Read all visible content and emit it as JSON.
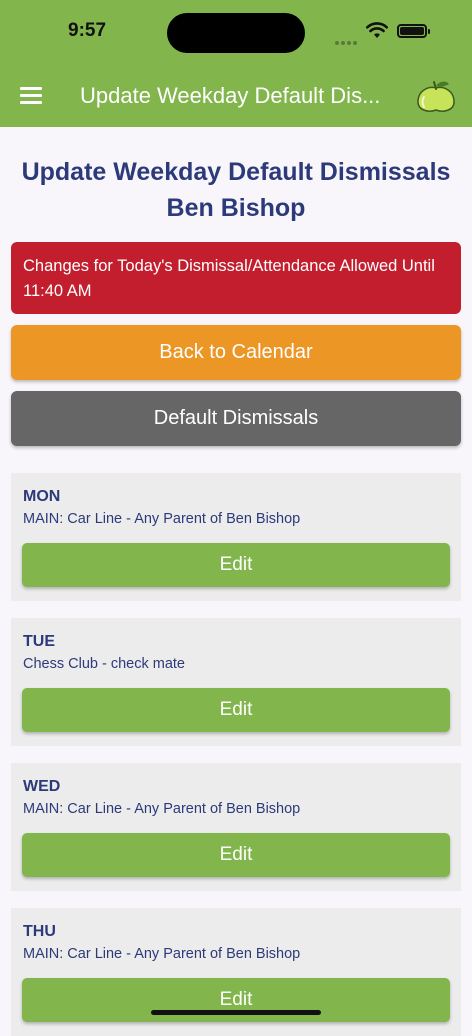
{
  "status": {
    "time": "9:57"
  },
  "header": {
    "title": "Update Weekday Default Dis..."
  },
  "page": {
    "title_line1": "Update Weekday Default Dismissals",
    "title_line2": "Ben Bishop"
  },
  "alert": {
    "text": "Changes for Today's Dismissal/Attendance Allowed Until 11:40 AM"
  },
  "buttons": {
    "back": "Back to Calendar",
    "defaults": "Default Dismissals"
  },
  "days": [
    {
      "day": "MON",
      "desc": "MAIN: Car Line - Any Parent of Ben Bishop",
      "edit": "Edit"
    },
    {
      "day": "TUE",
      "desc": "Chess Club - check mate",
      "edit": "Edit"
    },
    {
      "day": "WED",
      "desc": "MAIN: Car Line - Any Parent of Ben Bishop",
      "edit": "Edit"
    },
    {
      "day": "THU",
      "desc": "MAIN: Car Line - Any Parent of Ben Bishop",
      "edit": "Edit"
    }
  ],
  "colors": {
    "header": "#82b64d",
    "title": "#2d3a7a",
    "alert": "#c21e2e",
    "back_button": "#ec9626",
    "default_button": "#666666",
    "edit_button": "#82b64d"
  }
}
